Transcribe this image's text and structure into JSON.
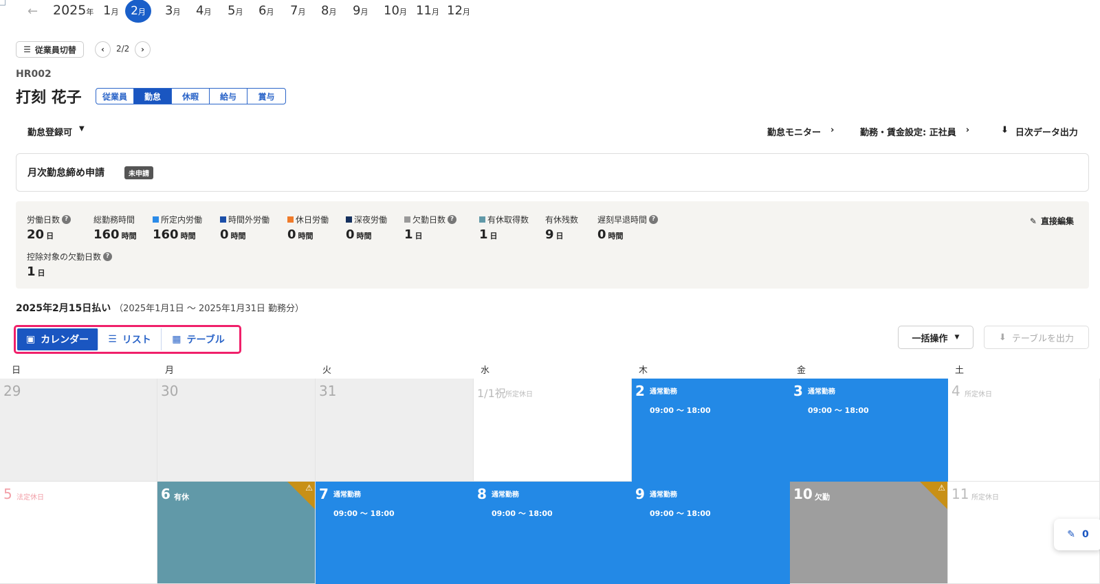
{
  "month_nav": {
    "year": "2025",
    "year_suffix": "年",
    "month_suffix": "月",
    "months": [
      "1",
      "2",
      "3",
      "4",
      "5",
      "6",
      "7",
      "8",
      "9",
      "10",
      "11",
      "12"
    ],
    "active_month": "2"
  },
  "employee_switch": {
    "label": "従業員切替",
    "page": "2/2"
  },
  "employee": {
    "code": "HR002",
    "name": "打刻 花子"
  },
  "tabs": [
    {
      "label": "従業員",
      "active": false
    },
    {
      "label": "勤怠",
      "active": true
    },
    {
      "label": "休暇",
      "active": false
    },
    {
      "label": "給与",
      "active": false
    },
    {
      "label": "賞与",
      "active": false
    }
  ],
  "toolbar": {
    "status_dropdown": "勤怠登録可",
    "monitor_link": "勤怠モニター",
    "settings_link": "勤務・賃金設定: 正社員",
    "export_daily": "日次データ出力"
  },
  "closing": {
    "title": "月次勤怠締め申請",
    "status": "未申請"
  },
  "summary": {
    "direct_edit": "直接編集",
    "stats": [
      {
        "label": "労働日数",
        "value": "20",
        "unit": "日",
        "help": true,
        "color": ""
      },
      {
        "label": "総勤務時間",
        "value": "160",
        "unit": "時間",
        "help": false,
        "color": ""
      },
      {
        "label": "所定内労働",
        "value": "160",
        "unit": "時間",
        "help": false,
        "color": "#2b8be8"
      },
      {
        "label": "時間外労働",
        "value": "0",
        "unit": "時間",
        "help": false,
        "color": "#1c4fa8"
      },
      {
        "label": "休日労働",
        "value": "0",
        "unit": "時間",
        "help": false,
        "color": "#ef7b2a"
      },
      {
        "label": "深夜労働",
        "value": "0",
        "unit": "時間",
        "help": false,
        "color": "#15305e"
      },
      {
        "label": "欠勤日数",
        "value": "1",
        "unit": "日",
        "help": true,
        "color": "#999999"
      },
      {
        "label": "有休取得数",
        "value": "1",
        "unit": "日",
        "help": false,
        "color": "#6199a8"
      },
      {
        "label": "有休残数",
        "value": "9",
        "unit": "日",
        "help": false,
        "color": ""
      },
      {
        "label": "遅刻早退時間",
        "value": "0",
        "unit": "時間",
        "help": true,
        "color": ""
      },
      {
        "label": "控除対象の欠勤日数",
        "value": "1",
        "unit": "日",
        "help": true,
        "color": ""
      }
    ]
  },
  "payment": {
    "title": "2025年2月15日払い",
    "period": "（2025年1月1日 ～ 2025年1月31日 勤務分）"
  },
  "view_switch": {
    "calendar": "カレンダー",
    "list": "リスト",
    "table": "テーブル"
  },
  "actions": {
    "bulk": "一括操作",
    "export_table": "テーブルを出力"
  },
  "calendar": {
    "weekdays": [
      "日",
      "月",
      "火",
      "水",
      "木",
      "金",
      "土"
    ],
    "week1": [
      {
        "day": "29",
        "tag": "",
        "time": ""
      },
      {
        "day": "30",
        "tag": "",
        "time": ""
      },
      {
        "day": "31",
        "tag": "",
        "time": ""
      },
      {
        "day": "1/1祝",
        "tag": "所定休日",
        "time": ""
      },
      {
        "day": "2",
        "tag": "通常勤務",
        "time": "09:00 ～ 18:00"
      },
      {
        "day": "3",
        "tag": "通常勤務",
        "time": "09:00 ～ 18:00"
      },
      {
        "day": "4",
        "tag": "所定休日",
        "time": ""
      }
    ],
    "week2": [
      {
        "day": "5",
        "tag": "法定休日",
        "time": ""
      },
      {
        "day": "6",
        "tag": "有休",
        "time": ""
      },
      {
        "day": "7",
        "tag": "通常勤務",
        "time": "09:00 ～ 18:00"
      },
      {
        "day": "8",
        "tag": "通常勤務",
        "time": "09:00 ～ 18:00"
      },
      {
        "day": "9",
        "tag": "通常勤務",
        "time": "09:00 ～ 18:00"
      },
      {
        "day": "10",
        "tag": "欠勤",
        "time": ""
      },
      {
        "day": "11",
        "tag": "所定休日",
        "time": ""
      }
    ]
  },
  "fab": {
    "count": "0"
  },
  "colors": {
    "accent": "#1a56c1",
    "work_blue": "#2389e6",
    "paid_leave": "#6199a8",
    "absence": "#9e9e9e",
    "warning": "#c89016",
    "highlight": "#f0206a"
  }
}
